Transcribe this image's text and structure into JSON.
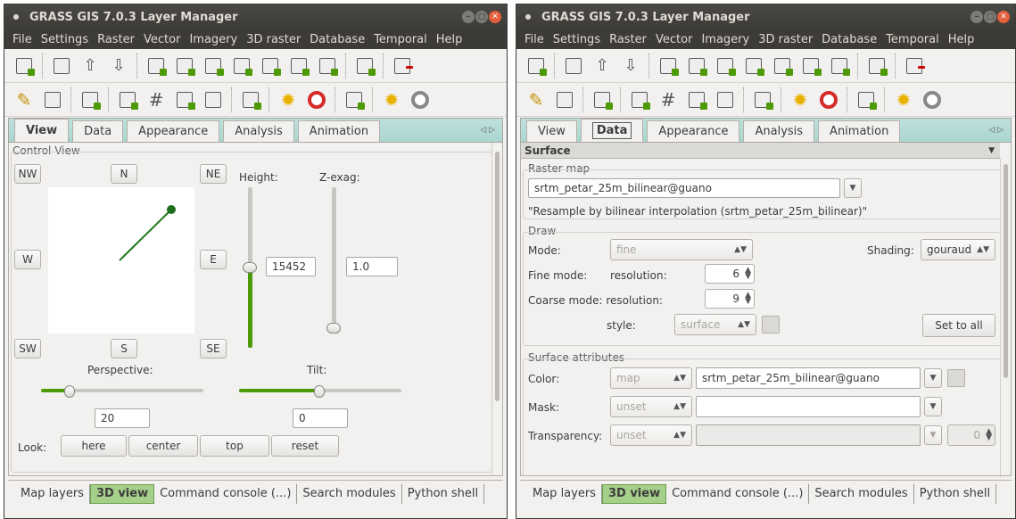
{
  "window_title": "GRASS GIS 7.0.3 Layer Manager",
  "menu": [
    "File",
    "Settings",
    "Raster",
    "Vector",
    "Imagery",
    "3D raster",
    "Database",
    "Temporal",
    "Help"
  ],
  "tabs": [
    "View",
    "Data",
    "Appearance",
    "Analysis",
    "Animation"
  ],
  "bottom_tabs": [
    "Map layers",
    "3D view",
    "Command console (...)",
    "Search modules",
    "Python shell"
  ],
  "colors": {
    "accent_green": "#4e9a06",
    "tab_bar": "#a9d6cf",
    "active_bottom_tab": "#a5d08a"
  },
  "left": {
    "active_tab": "View",
    "control_view_title": "Control View",
    "dir_buttons": {
      "nw": "NW",
      "n": "N",
      "ne": "NE",
      "w": "W",
      "e": "E",
      "sw": "SW",
      "s": "S",
      "se": "SE"
    },
    "height_label": "Height:",
    "height_value": "15452",
    "zexag_label": "Z-exag:",
    "zexag_value": "1.0",
    "perspective_label": "Perspective:",
    "perspective_value": "20",
    "tilt_label": "Tilt:",
    "tilt_value": "0",
    "look_label": "Look:",
    "look_buttons": [
      "here",
      "center",
      "top",
      "reset"
    ]
  },
  "right": {
    "active_tab": "Data",
    "panel_title": "Surface",
    "raster_map_title": "Raster map",
    "raster_map_value": "srtm_petar_25m_bilinear@guano",
    "raster_description": "\"Resample by bilinear interpolation (srtm_petar_25m_bilinear)\"",
    "draw_title": "Draw",
    "mode_label": "Mode:",
    "mode_value": "fine",
    "shading_label": "Shading:",
    "shading_value": "gouraud",
    "fine_mode_label": "Fine mode:",
    "resolution_label": "resolution:",
    "fine_resolution": "6",
    "coarse_mode_label": "Coarse mode: resolution:",
    "coarse_resolution": "9",
    "style_label": "style:",
    "style_value": "surface",
    "set_to_all": "Set to all",
    "surface_attr_title": "Surface attributes",
    "color_label": "Color:",
    "color_mode": "map",
    "color_value": "srtm_petar_25m_bilinear@guano",
    "mask_label": "Mask:",
    "mask_mode": "unset",
    "transparency_label": "Transparency:",
    "transparency_mode": "unset",
    "transparency_value": "0"
  }
}
